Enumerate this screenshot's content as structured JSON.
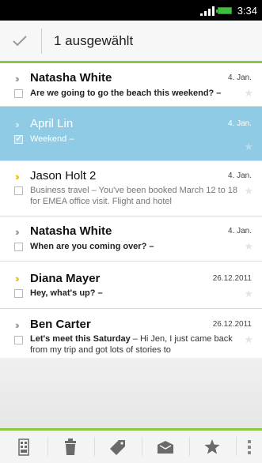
{
  "status_bar": {
    "time": "3:34"
  },
  "header": {
    "selected_label": "1 ausgewählt"
  },
  "messages": [
    {
      "sender": "Natasha White",
      "date": "4. Jan.",
      "subject": "Are we going to go the beach this weekend? –",
      "preview": "",
      "unread": true,
      "selected": false,
      "important": false
    },
    {
      "sender": "April Lin",
      "date": "4. Jan.",
      "subject": "Weekend –",
      "preview": "",
      "unread": false,
      "selected": true,
      "important": false
    },
    {
      "sender": "Jason Holt  2",
      "date": "4. Jan.",
      "subject": "Business travel – You've been booked March 12 to 18 for EMEA office visit. Flight and hotel",
      "preview": "",
      "unread": false,
      "selected": false,
      "important": true
    },
    {
      "sender": "Natasha White",
      "date": "4. Jan.",
      "subject": "When are you coming over? –",
      "preview": "",
      "unread": true,
      "selected": false,
      "important": false
    },
    {
      "sender": "Diana Mayer",
      "date": "26.12.2011",
      "subject": "Hey, what's up? –",
      "preview": "",
      "unread": true,
      "selected": false,
      "important": true
    },
    {
      "sender": "Ben Carter",
      "date": "26.12.2011",
      "subject_bold": "Let's meet this Saturday",
      "subject_rest": " – Hi Jen, I just came back from my trip and got lots of stories to",
      "unread": true,
      "selected": false,
      "important": false
    }
  ],
  "toolbar": {
    "icons": [
      "mark-unread-icon",
      "trash-icon",
      "label-icon",
      "move-to-folder-icon",
      "star-icon",
      "overflow-menu-icon"
    ]
  },
  "colors": {
    "accent": "#8dc63f",
    "selection": "#8fcbe5",
    "important": "#f0c419"
  }
}
